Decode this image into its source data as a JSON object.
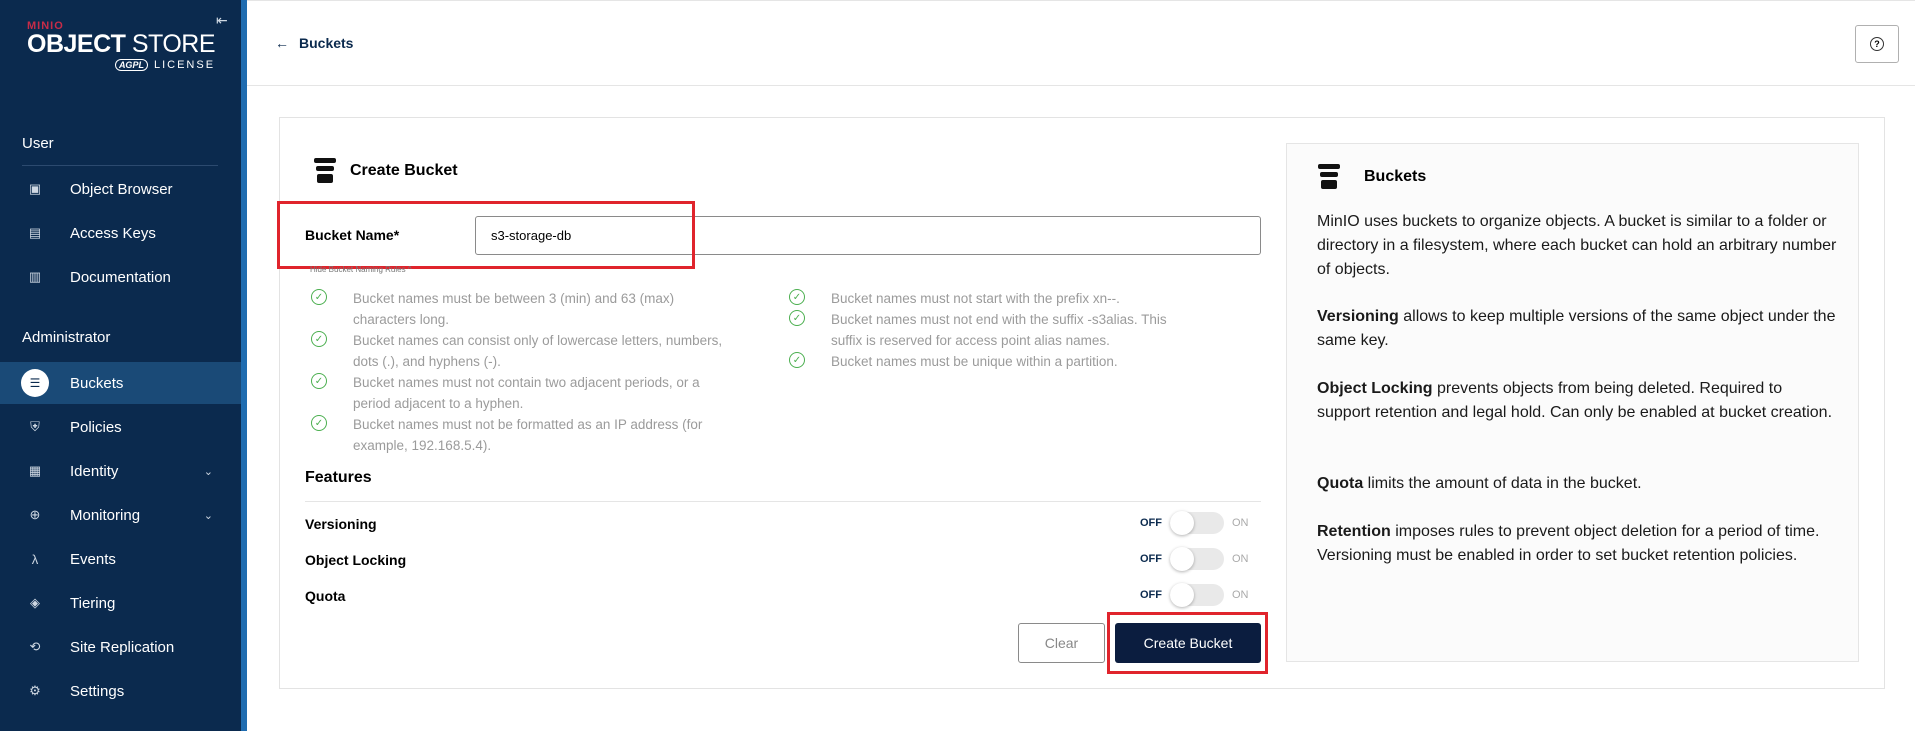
{
  "sidebar": {
    "brand": "MINIO",
    "product_bold": "OBJECT",
    "product_rest": "STORE",
    "license_badge": "AGPL",
    "license_text": "LICENSE",
    "user_section": "User",
    "user_items": [
      {
        "label": "Object Browser",
        "icon": "object-browser-icon"
      },
      {
        "label": "Access Keys",
        "icon": "access-keys-icon"
      },
      {
        "label": "Documentation",
        "icon": "documentation-icon"
      }
    ],
    "admin_section": "Administrator",
    "admin_items": [
      {
        "label": "Buckets",
        "icon": "buckets-icon",
        "active": true
      },
      {
        "label": "Policies",
        "icon": "policies-icon"
      },
      {
        "label": "Identity",
        "icon": "identity-icon",
        "expandable": true
      },
      {
        "label": "Monitoring",
        "icon": "monitoring-icon",
        "expandable": true
      },
      {
        "label": "Events",
        "icon": "events-icon"
      },
      {
        "label": "Tiering",
        "icon": "tiering-icon"
      },
      {
        "label": "Site Replication",
        "icon": "site-replication-icon"
      },
      {
        "label": "Settings",
        "icon": "settings-icon"
      }
    ]
  },
  "header": {
    "back_label": "Buckets",
    "help_icon": "?"
  },
  "form": {
    "title": "Create Bucket",
    "bucket_name_label": "Bucket Name*",
    "bucket_name_value": "s3-storage-db",
    "rules_toggle": "Hide Bucket Naming Rules ^",
    "rules_left": [
      "Bucket names must be between 3 (min) and 63 (max) characters long.",
      "Bucket names can consist only of lowercase letters, numbers, dots (.), and hyphens (-).",
      "Bucket names must not contain two adjacent periods, or a period adjacent to a hyphen.",
      "Bucket names must not be formatted as an IP address (for example, 192.168.5.4)."
    ],
    "rules_right": [
      "Bucket names must not start with the prefix xn--.",
      "Bucket names must not end with the suffix -s3alias. This suffix is reserved for access point alias names.",
      "Bucket names must be unique within a partition."
    ],
    "features_title": "Features",
    "features": [
      {
        "label": "Versioning",
        "off": "OFF",
        "on": "ON",
        "enabled": false
      },
      {
        "label": "Object Locking",
        "off": "OFF",
        "on": "ON",
        "enabled": false
      },
      {
        "label": "Quota",
        "off": "OFF",
        "on": "ON",
        "enabled": false
      }
    ],
    "clear_label": "Clear",
    "create_label": "Create Bucket"
  },
  "info": {
    "title": "Buckets",
    "intro": "MinIO uses buckets to organize objects. A bucket is similar to a folder or directory in a filesystem, where each bucket can hold an arbitrary number of objects.",
    "versioning_term": "Versioning",
    "versioning_text": " allows to keep multiple versions of the same object under the same key.",
    "locking_term": "Object Locking",
    "locking_text": " prevents objects from being deleted. Required to support retention and legal hold. Can only be enabled at bucket creation.",
    "quota_term": "Quota",
    "quota_text": " limits the amount of data in the bucket.",
    "retention_term": "Retention",
    "retention_text": " imposes rules to prevent object deletion for a period of time. Versioning must be enabled in order to set bucket retention policies."
  },
  "colors": {
    "sidebar_bg": "#0b2a4e",
    "primary_button": "#0b1d3f",
    "highlight": "#e0242c",
    "check": "#4caf50"
  }
}
